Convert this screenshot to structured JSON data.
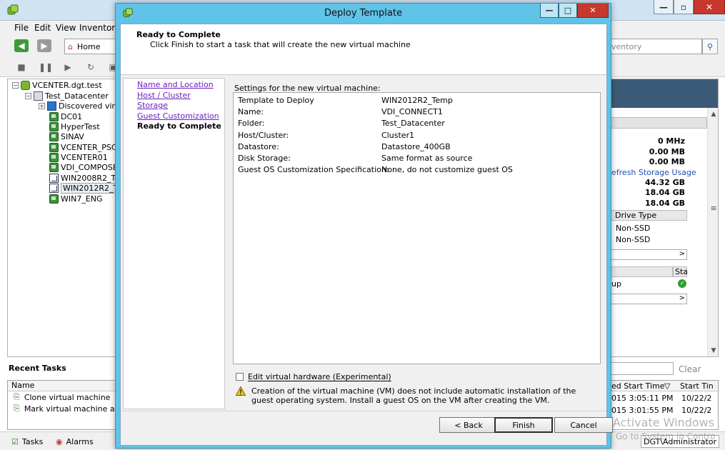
{
  "main": {
    "menu": [
      "File",
      "Edit",
      "View",
      "Inventory"
    ],
    "home_label": "Home",
    "search_placeholder": "ventory",
    "tree": [
      {
        "label": "VCENTER.dgt.test",
        "icon": "vcenter-icon"
      },
      {
        "label": "Test_Datacenter",
        "icon": "datacenter-icon"
      },
      {
        "label": "Discovered virt",
        "icon": "folder-icon"
      },
      {
        "label": "DC01",
        "icon": "vm-icon"
      },
      {
        "label": "HyperTest",
        "icon": "vm-icon"
      },
      {
        "label": "SINAV",
        "icon": "vm-icon"
      },
      {
        "label": "VCENTER_PSC",
        "icon": "vm-icon"
      },
      {
        "label": "VCENTER01",
        "icon": "vm-icon"
      },
      {
        "label": "VDI_COMPOSE",
        "icon": "vm-icon"
      },
      {
        "label": "WIN2008R2_T",
        "icon": "template-icon"
      },
      {
        "label": "WIN2012R2_T",
        "icon": "template-icon"
      },
      {
        "label": "WIN7_ENG",
        "icon": "vm-icon"
      }
    ],
    "recent_tasks_title": "Recent Tasks",
    "tasks_column": "Name",
    "tasks": [
      "Clone virtual machine",
      "Mark virtual machine as t"
    ],
    "status_tabs": [
      "Tasks",
      "Alarms"
    ],
    "status_user": "DGT\\Administrator",
    "right_panel": {
      "values": [
        "0 MHz",
        "0.00 MB",
        "0.00 MB"
      ],
      "refresh_link": "efresh Storage Usage",
      "storage": [
        "44.32 GB",
        "18.04 GB",
        "18.04 GB"
      ],
      "drive_type_header": "Drive Type",
      "drives": [
        "Non-SSD",
        "Non-SSD"
      ],
      "state_header": "Sta",
      "network_row": "up",
      "clear_label": "Clear",
      "tasks_col_start": "ed Start Time",
      "tasks_col_start2": "Start Tin",
      "task_times": [
        "015 3:05:11 PM",
        "015 3:01:55 PM"
      ],
      "task_dates": [
        "10/22/2",
        "10/22/2"
      ]
    },
    "watermark": "Activate Windows",
    "watermark2": "Go to System in Contro"
  },
  "dialog": {
    "title": "Deploy Template",
    "header_title": "Ready to Complete",
    "header_subtitle": "Click Finish to start a task that will create the new virtual machine",
    "steps": [
      "Name and Location",
      "Host / Cluster",
      "Storage",
      "Guest Customization",
      "Ready to Complete"
    ],
    "settings_label": "Settings for the new virtual machine:",
    "settings": [
      {
        "key": "Template to Deploy",
        "value": "WIN2012R2_Temp"
      },
      {
        "key": "Name:",
        "value": "VDI_CONNECT1"
      },
      {
        "key": "Folder:",
        "value": "Test_Datacenter"
      },
      {
        "key": "Host/Cluster:",
        "value": "Cluster1"
      },
      {
        "key": "Datastore:",
        "value": "Datastore_400GB"
      },
      {
        "key": "Disk Storage:",
        "value": "Same format as source"
      },
      {
        "key": "Guest OS Customization Specification:",
        "value": "None, do not customize guest OS"
      }
    ],
    "edit_hw_label": "Edit virtual hardware (Experimental)",
    "warning": "Creation of the virtual machine (VM) does not include automatic installation of the guest operating system. Install a guest OS on the VM after creating the VM.",
    "buttons": {
      "back": "< Back",
      "finish": "Finish",
      "cancel": "Cancel"
    }
  },
  "colors": {
    "dialog_frame": "#60c3e8",
    "link": "#6a1fbf",
    "close_button": "#c7372b"
  }
}
